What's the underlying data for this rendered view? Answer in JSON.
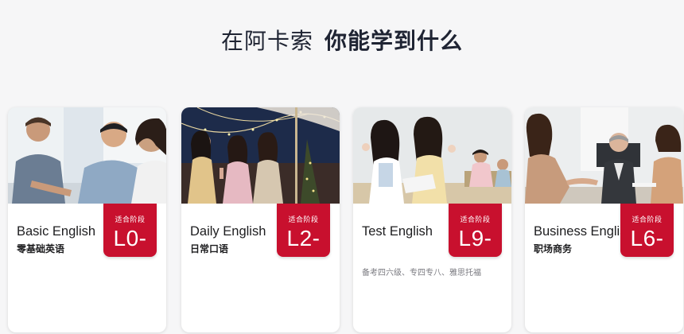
{
  "section": {
    "heading_light": "在阿卡索",
    "heading_bold": "你能学到什么"
  },
  "cards": [
    {
      "title": "Basic English",
      "subtitle": "零基础英语",
      "badge_label": "适合阶段",
      "badge_code": "L0-",
      "description": ""
    },
    {
      "title": "Daily English",
      "subtitle": "日常口语",
      "badge_label": "适合阶段",
      "badge_code": "L2-",
      "description": ""
    },
    {
      "title": "Test English",
      "subtitle": "",
      "badge_label": "适合阶段",
      "badge_code": "L9-",
      "description": "备考四六级、专四专八、雅思托福"
    },
    {
      "title": "Business English",
      "subtitle": "职场商务",
      "badge_label": "适合阶段",
      "badge_code": "L6-",
      "description": ""
    }
  ],
  "colors": {
    "accent": "#c8102e",
    "background": "#f6f6f7",
    "card": "#ffffff"
  }
}
